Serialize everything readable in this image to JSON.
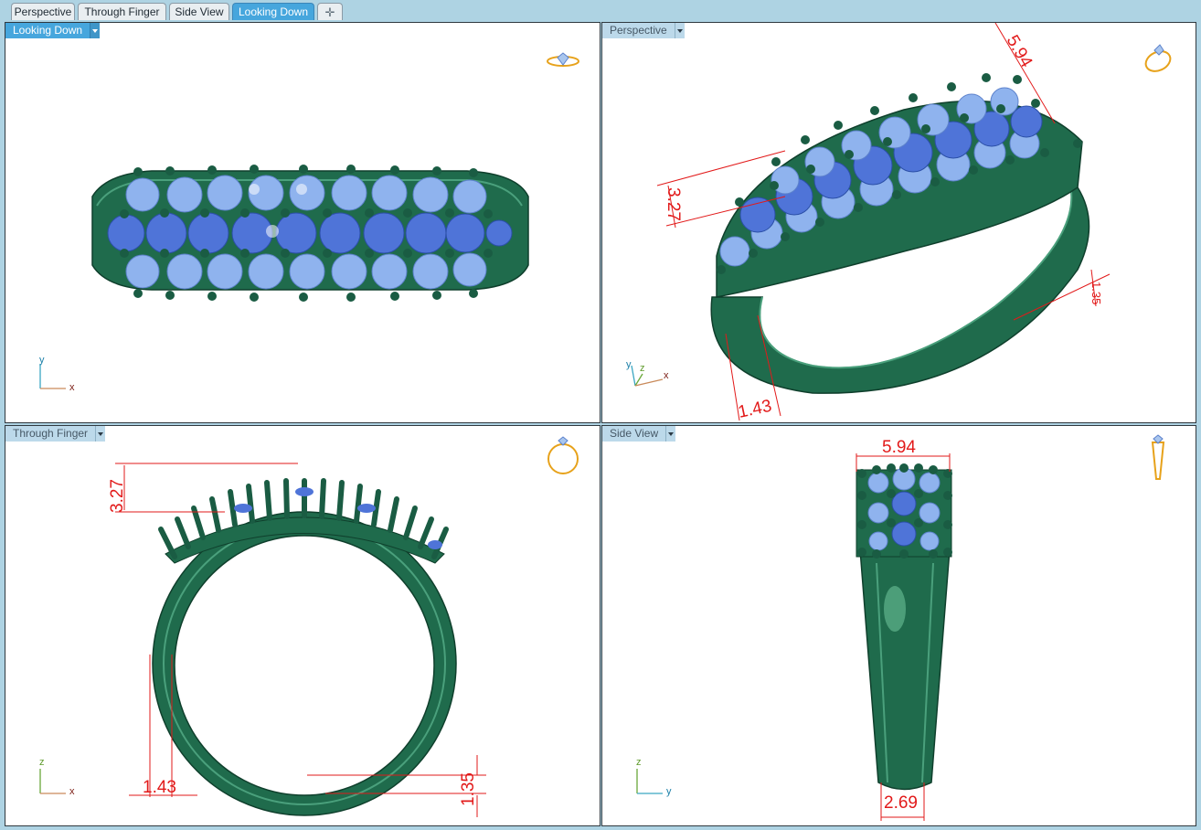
{
  "tabs": [
    {
      "label": "Perspective"
    },
    {
      "label": "Through Finger"
    },
    {
      "label": "Side View"
    },
    {
      "label": "Looking Down"
    }
  ],
  "tab_add_glyph": "✛",
  "viewports": {
    "top_left": {
      "title": "Looking Down",
      "axes": {
        "a": "y",
        "b": "x"
      },
      "icon": "ring-front-icon"
    },
    "top_right": {
      "title": "Perspective",
      "axes": {
        "a": "y",
        "b": "z",
        "c": "x"
      },
      "icon": "ring-perspective-icon",
      "dims": {
        "width": "5.94",
        "height": "3.27",
        "band": "1.35",
        "thickness": "1.43"
      }
    },
    "bottom_left": {
      "title": "Through Finger",
      "axes": {
        "a": "z",
        "b": "x"
      },
      "icon": "ring-side-icon",
      "dims": {
        "height": "3.27",
        "thickness": "1.43",
        "band": "1.35"
      }
    },
    "bottom_right": {
      "title": "Side View",
      "axes": {
        "a": "z",
        "b": "y"
      },
      "icon": "ring-profile-icon",
      "dims": {
        "width": "5.94",
        "bottom": "2.69"
      }
    }
  },
  "colors": {
    "ring_green": "#1f6b4c",
    "stone_blue": "#4f74d8",
    "dimension_red": "#e21a1a",
    "active_tab": "#46a6dd"
  }
}
